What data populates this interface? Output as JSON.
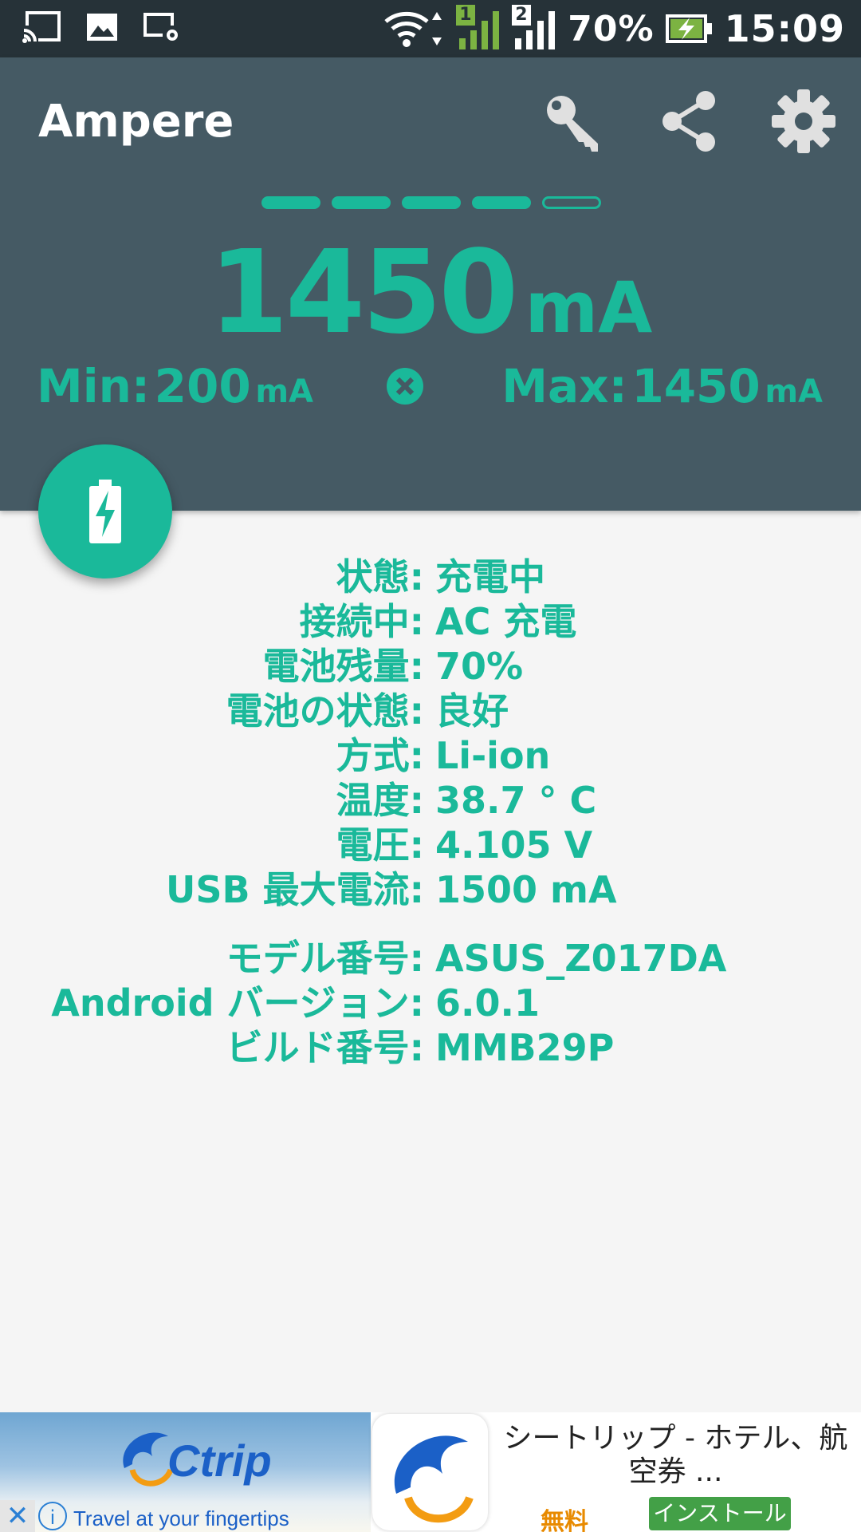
{
  "status_bar": {
    "battery_percent": "70%",
    "time": "15:09",
    "sim1_label": "1",
    "sim2_label": "2",
    "icons": [
      "cast-icon",
      "image-icon",
      "screen-settings-icon",
      "wifi-icon",
      "signal-sim1-icon",
      "signal-sim2-icon",
      "battery-charging-icon"
    ]
  },
  "app_bar": {
    "title": "Ampere",
    "actions": [
      "key-icon",
      "share-icon",
      "settings-icon"
    ]
  },
  "meter": {
    "level_bars_total": 5,
    "level_bars_filled": 4,
    "current_value": "1450",
    "current_unit": "mA",
    "min_label": "Min:",
    "min_value": "200",
    "min_unit": "mA",
    "max_label": "Max:",
    "max_value": "1450",
    "max_unit": "mA",
    "accent_color": "#1ab99a",
    "header_color": "#455a64"
  },
  "info": {
    "rows": [
      {
        "key": "状態:",
        "value": "充電中"
      },
      {
        "key": "接続中:",
        "value": "AC 充電"
      },
      {
        "key": "電池残量:",
        "value": "70%"
      },
      {
        "key": "電池の状態:",
        "value": "良好"
      },
      {
        "key": "方式:",
        "value": "Li-ion"
      },
      {
        "key": "温度:",
        "value": "38.7 ° C"
      },
      {
        "key": "電圧:",
        "value": "4.105 V"
      },
      {
        "key": "USB 最大電流:",
        "value": "1500 mA"
      }
    ],
    "device_rows": [
      {
        "key": "モデル番号:",
        "value": "ASUS_Z017DA"
      },
      {
        "key": "Android バージョン:",
        "value": "6.0.1"
      },
      {
        "key": "ビルド番号:",
        "value": "MMB29P"
      }
    ]
  },
  "ad": {
    "brand": "Ctrip",
    "tagline": "Travel at your fingertips",
    "title": "シートリップ - ホテル、航空券 ...",
    "price_label": "無料",
    "install_label": "インストール",
    "close_symbol": "✕",
    "info_symbol": "i"
  }
}
